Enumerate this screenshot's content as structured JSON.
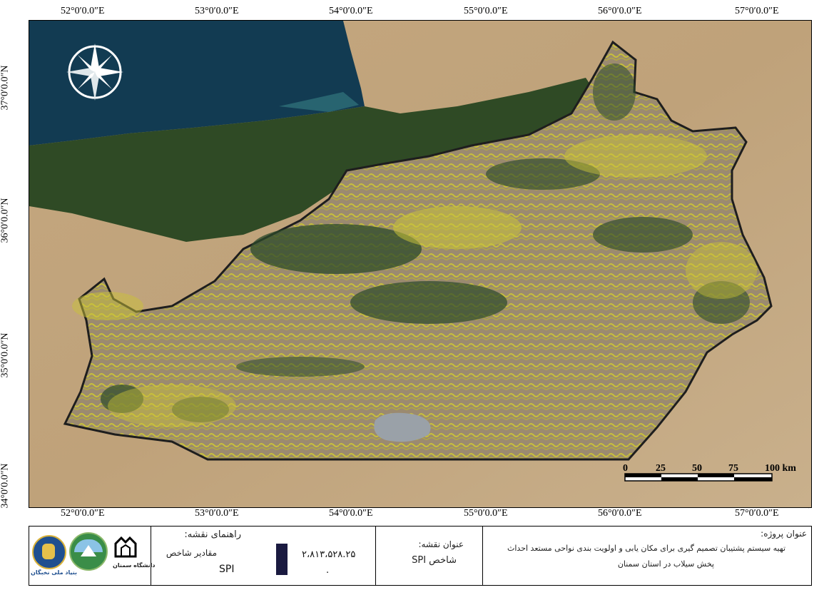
{
  "graticule": {
    "longitudes": [
      "52°0′0.0″E",
      "53°0′0.0″E",
      "54°0′0.0″E",
      "55°0′0.0″E",
      "56°0′0.0″E",
      "57°0′0.0″E"
    ],
    "latitudes": [
      "37°0′0.0″N",
      "36°0′0.0″N",
      "35°0′0.0″N",
      "34°0′0.0″N"
    ]
  },
  "scalebar": {
    "ticks": [
      "0",
      "25",
      "50",
      "75",
      "100 km"
    ]
  },
  "legend": {
    "project_title_label": "عنوان پروژه:",
    "project_title_line1": "تهیه سیستم پشتیبان تصمیم گیری برای مکان یابی و اولویت بندی نواحی مستعد احداث",
    "project_title_line2": "پخش سیلاب در استان سمنان",
    "map_title_label": "عنوان نقشه:",
    "map_title_value": "شاخص SPI",
    "map_legend_label": "راهنمای نقشه:",
    "index_values_label": "مقادیر شاخص",
    "index_name": "SPI",
    "value_high": "۲،۸۱۳،۵۲۸.۲۵",
    "value_low": ".",
    "ramp_color": "#1a1a40"
  },
  "logos": {
    "logo1_text": "بنیاد ملی نخبگان",
    "logo3_text": "دانشگاه سمنان"
  },
  "colors": {
    "sea": "#123b52",
    "land": "#b99d77",
    "forest": "#2f4a25",
    "province_base": "#9a8a72",
    "spi_yellow": "#c9c23a",
    "spi_dark": "#2c4a2a"
  }
}
